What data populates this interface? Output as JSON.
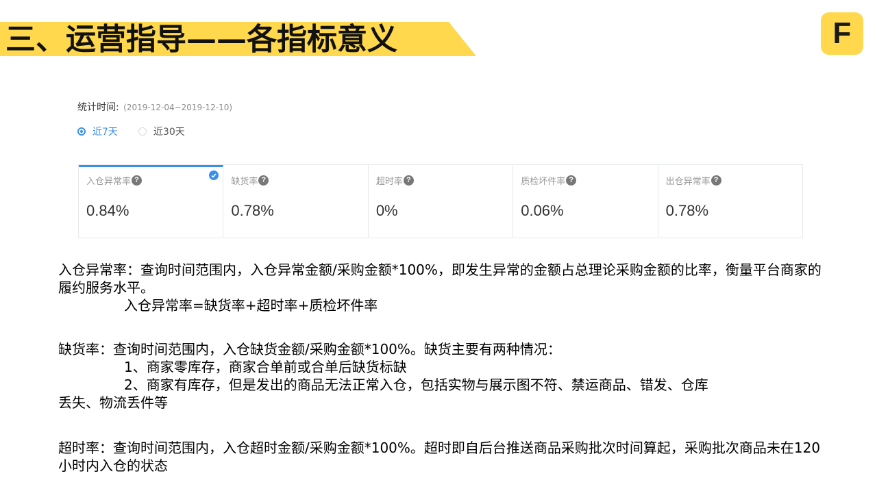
{
  "header": {
    "title": "三、运营指导——各指标意义",
    "logo_letter": "F"
  },
  "stat_period": {
    "label": "统计时间:",
    "range": "(2019-12-04~2019-12-10)"
  },
  "range_options": [
    {
      "label": "近7天",
      "selected": true
    },
    {
      "label": "近30天",
      "selected": false
    }
  ],
  "metrics": [
    {
      "label": "入仓异常率",
      "value": "0.84%",
      "active": true
    },
    {
      "label": "缺货率",
      "value": "0.78%",
      "active": false
    },
    {
      "label": "超时率",
      "value": "0%",
      "active": false
    },
    {
      "label": "质检坏件率",
      "value": "0.06%",
      "active": false
    },
    {
      "label": "出仓异常率",
      "value": "0.78%",
      "active": false
    }
  ],
  "help_glyph": "?",
  "description": {
    "inbound": {
      "text": "入仓异常率：查询时间范围内，入仓异常金额/采购金额*100%，即发生异常的金额占总理论采购金额的比率，衡量平台商家的履约服务水平。",
      "formula": "入仓异常率=缺货率+超时率+质检坏件率"
    },
    "stockout": {
      "text": "缺货率：查询时间范围内，入仓缺货金额/采购金额*100%。缺货主要有两种情况：",
      "case1": "1、商家零库存，商家合单前或合单后缺货标缺",
      "case2_first": "2、商家有库存，但是发出的商品无法正常入仓，包括实物与展示图不符、禁运商品、错发、仓库",
      "case2_rest": "丢失、物流丢件等"
    },
    "timeout": {
      "text": "超时率：查询时间范围内，入仓超时金额/采购金额*100%。超时即自后台推送商品采购批次时间算起，采购批次商品未在120小时内入仓的状态"
    }
  },
  "colors": {
    "accent_yellow": "#FFD84D",
    "selection_blue": "#3B8EEA"
  }
}
